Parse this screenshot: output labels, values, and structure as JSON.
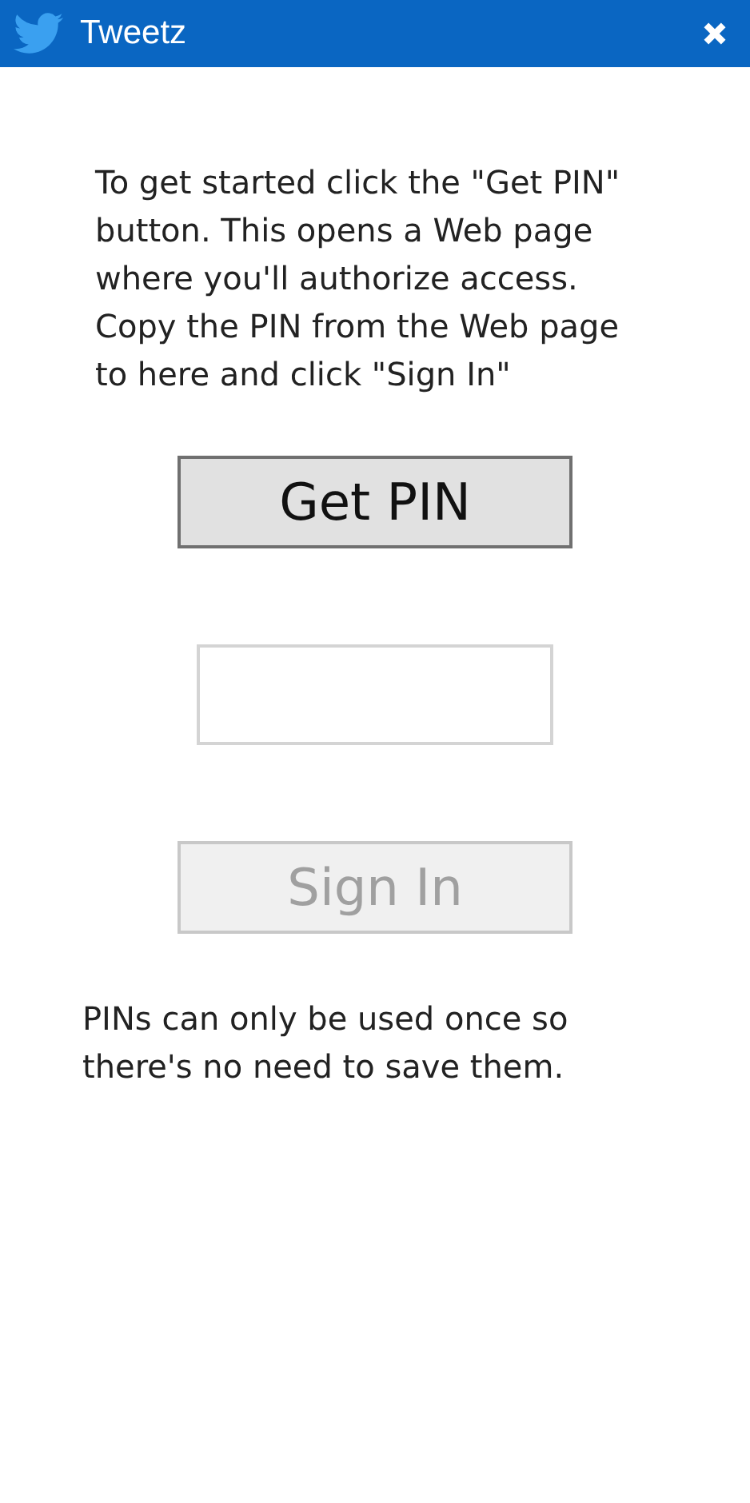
{
  "window": {
    "title": "Tweetz"
  },
  "instructions": "To get started click the \"Get PIN\" button. This opens a Web page where you'll authorize access. Copy the PIN from the Web page to here and click \"Sign In\"",
  "get_pin_button": {
    "label": "Get PIN",
    "disabled": false
  },
  "sign_in_button": {
    "label": "Sign In",
    "disabled": true
  },
  "note": "PINs can only be used once so there's no need to save them."
}
